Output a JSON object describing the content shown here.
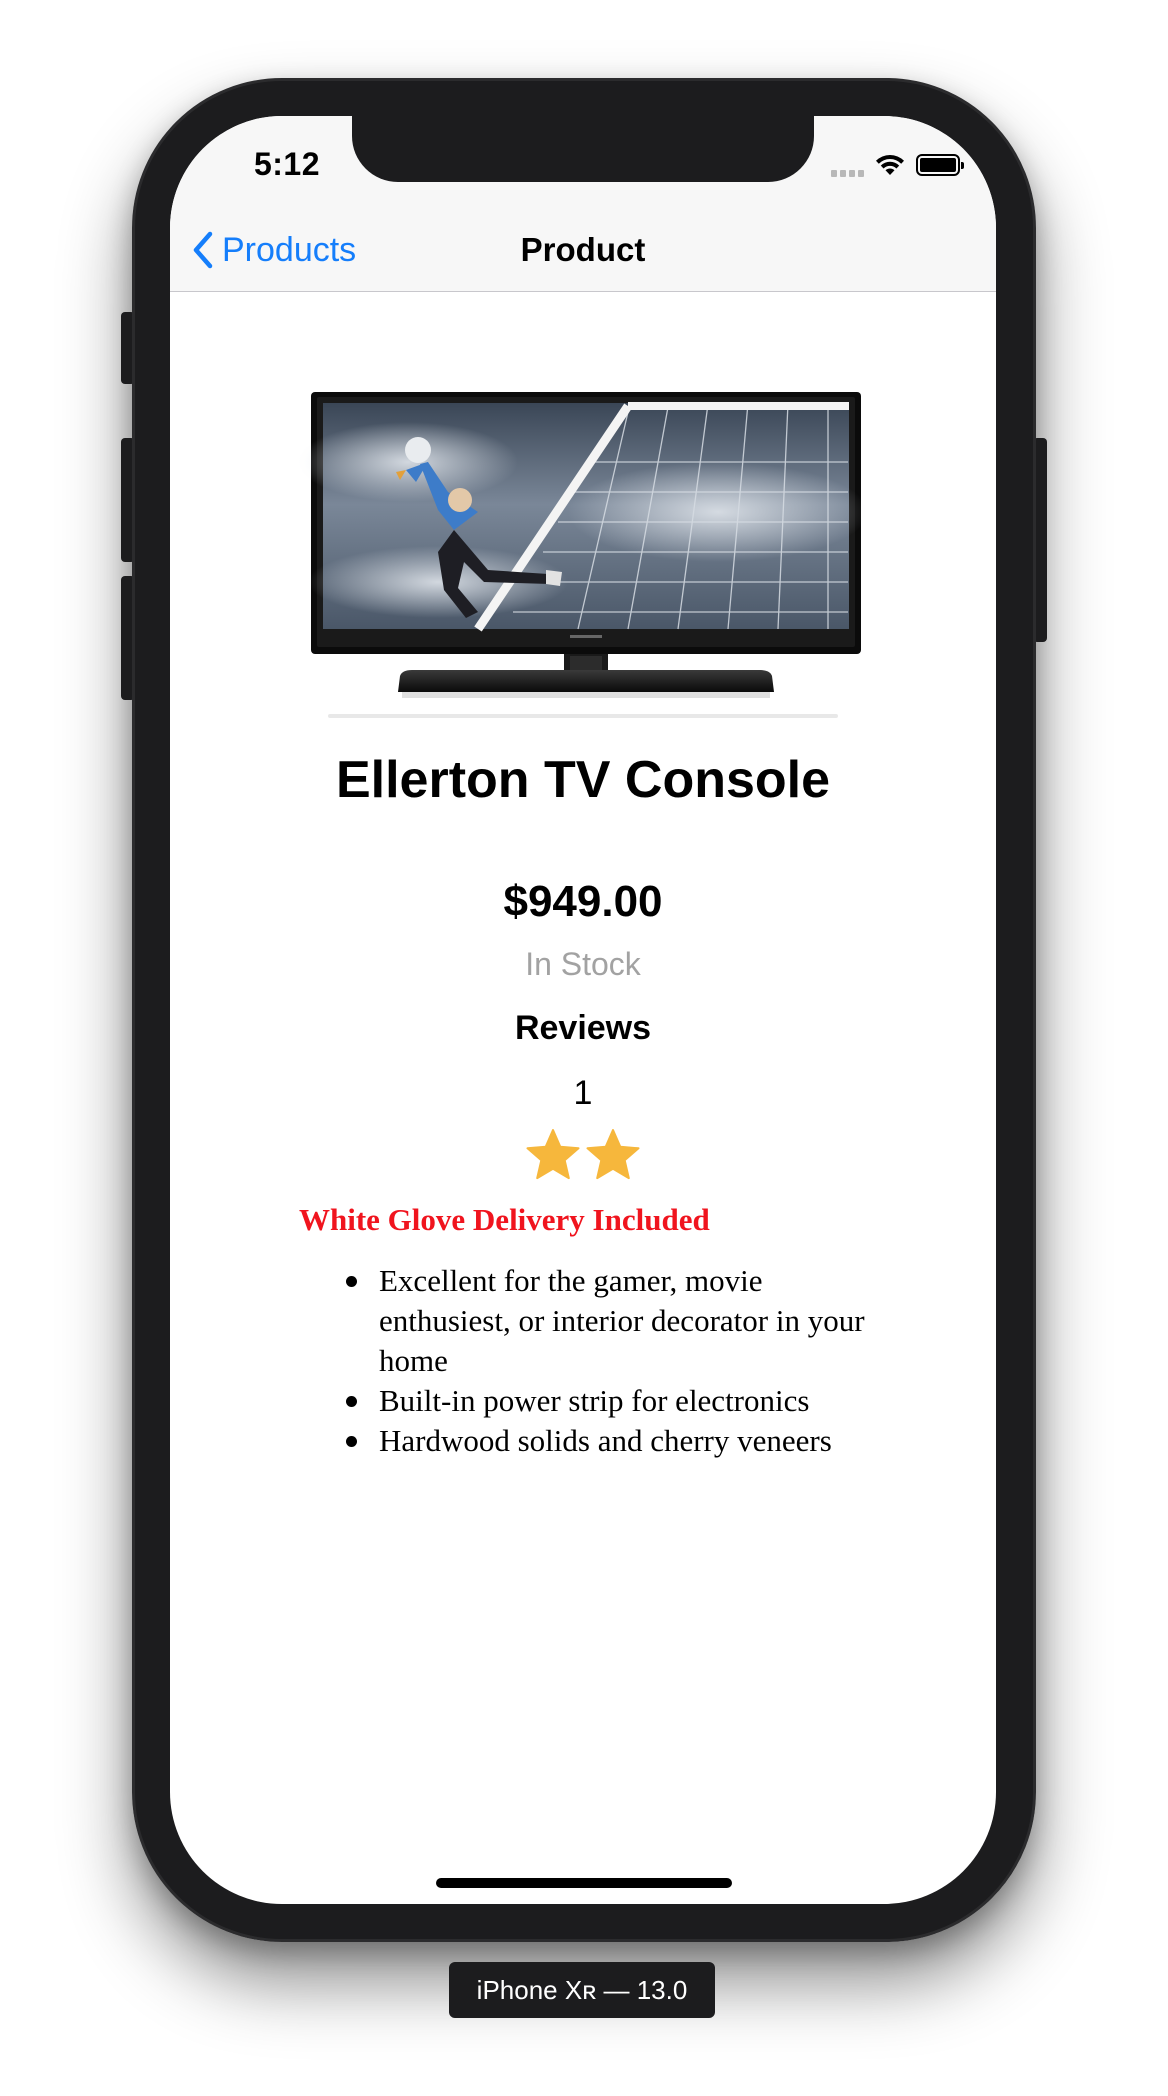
{
  "status_bar": {
    "time": "5:12",
    "icons": [
      "signal-icon",
      "wifi-icon",
      "battery-icon"
    ]
  },
  "nav": {
    "back_label": "Products",
    "title": "Product"
  },
  "product": {
    "image": "tv-product-image",
    "name": "Ellerton TV Console",
    "price": "$949.00",
    "stock": "In Stock",
    "reviews_heading": "Reviews",
    "reviews_count": "1",
    "rating": 2,
    "delivery_note": "White Glove Delivery Included",
    "features": [
      "Excellent for the gamer, movie enthusiest, or interior decorator in your home",
      "Built-in power strip for electronics",
      "Hardwood solids and cherry veneers"
    ]
  },
  "simulator_label": "iPhone Xʀ — 13.0",
  "colors": {
    "ios_blue": "#157efb",
    "star": "#f6b73c",
    "delivery_red": "#f0141e",
    "stock_gray": "#a2a2a2",
    "device": "#1c1c1e"
  }
}
